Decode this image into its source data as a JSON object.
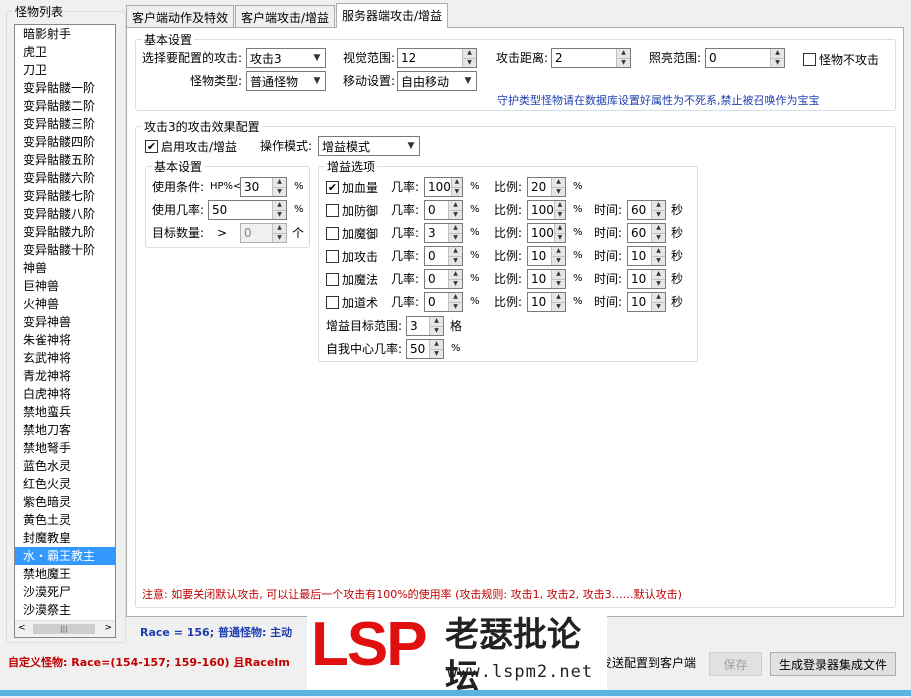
{
  "sidebar": {
    "title": "怪物列表",
    "items": [
      "暗影射手",
      "虎卫",
      "刀卫",
      "变异骷髅一阶",
      "变异骷髅二阶",
      "变异骷髅三阶",
      "变异骷髅四阶",
      "变异骷髅五阶",
      "变异骷髅六阶",
      "变异骷髅七阶",
      "变异骷髅八阶",
      "变异骷髅九阶",
      "变异骷髅十阶",
      "神兽",
      "巨神兽",
      "火神兽",
      "变异神兽",
      "朱雀神将",
      "玄武神将",
      "青龙神将",
      "白虎神将",
      "禁地蛮兵",
      "禁地刀客",
      "禁地弩手",
      "蓝色水灵",
      "红色火灵",
      "紫色暗灵",
      "黄色土灵",
      "封魔教皇",
      "水・霸王教主",
      "禁地魔王",
      "沙漠死尸",
      "沙漠祭主"
    ],
    "selected_index": 29
  },
  "tabs": [
    "客户端动作及特效",
    "客户端攻击/增益",
    "服务器端攻击/增益"
  ],
  "active_tab": 2,
  "basic": {
    "legend": "基本设置",
    "attack_select_label": "选择要配置的攻击:",
    "attack_select_value": "攻击3",
    "view_range_label": "视觉范围:",
    "view_range_value": "12",
    "attack_distance_label": "攻击距离:",
    "attack_distance_value": "2",
    "light_range_label": "照亮范围:",
    "light_range_value": "0",
    "no_attack_label": "怪物不攻击",
    "monster_type_label": "怪物类型:",
    "monster_type_value": "普通怪物",
    "move_setting_label": "移动设置:",
    "move_setting_value": "自由移动",
    "guard_note": "守护类型怪物请在数据库设置好属性为不死系,禁止被召唤作为宝宝"
  },
  "effect": {
    "legend": "攻击3的攻击效果配置",
    "enable_label": "启用攻击/增益",
    "mode_label": "操作模式:",
    "mode_value": "增益模式",
    "cond": {
      "legend": "基本设置",
      "use_condition_label": "使用条件:",
      "hp_prefix": "HP%<",
      "use_condition_value": "30",
      "use_rate_label": "使用几率:",
      "use_rate_value": "50",
      "target_count_label": "目标数量:",
      "target_gt": ">",
      "target_count_value": "0",
      "pct": "%",
      "unit_ge": "个"
    },
    "buff": {
      "legend": "增益选项",
      "rate_label": "几率:",
      "ratio_label": "比例:",
      "time_label": "时间:",
      "pct": "%",
      "sec": "秒",
      "rows": [
        {
          "name": "加血量",
          "checked": "✔",
          "rate": "100",
          "ratio": "20",
          "time": ""
        },
        {
          "name": "加防御",
          "checked": "",
          "rate": "0",
          "ratio": "100",
          "time": "60"
        },
        {
          "name": "加魔御",
          "checked": "",
          "rate": "3",
          "ratio": "100",
          "time": "60"
        },
        {
          "name": "加攻击",
          "checked": "",
          "rate": "0",
          "ratio": "10",
          "time": "10"
        },
        {
          "name": "加魔法",
          "checked": "",
          "rate": "0",
          "ratio": "10",
          "time": "10"
        },
        {
          "name": "加道术",
          "checked": "",
          "rate": "0",
          "ratio": "10",
          "time": "10"
        }
      ],
      "target_range_label": "增益目标范围:",
      "target_range_value": "3",
      "target_range_unit": "格",
      "self_rate_label": "自我中心几率:",
      "self_rate_value": "50",
      "self_rate_unit": "%"
    }
  },
  "note": "注意: 如要关闭默认攻击, 可以让最后一个攻击有100%的使用率 (攻击规则: 攻击1, 攻击2, 攻击3……默认攻击)",
  "race_line": "Race = 156; 普通怪物: 主动",
  "custom_line": "自定义怪物: Race=(154-157; 159-160) 且RaceIm",
  "send_line": "发送配置到客户端",
  "buttons": {
    "save": "保存",
    "generate": "生成登录器集成文件"
  },
  "watermark": {
    "logo": "LSP",
    "site_name": "老瑟批论坛",
    "url": "www.lspm2.net"
  },
  "colors": {
    "selection": "#3399ff",
    "note_red": "#c00000",
    "info_blue": "#1f3fb0",
    "logo_red": "#e01010"
  }
}
